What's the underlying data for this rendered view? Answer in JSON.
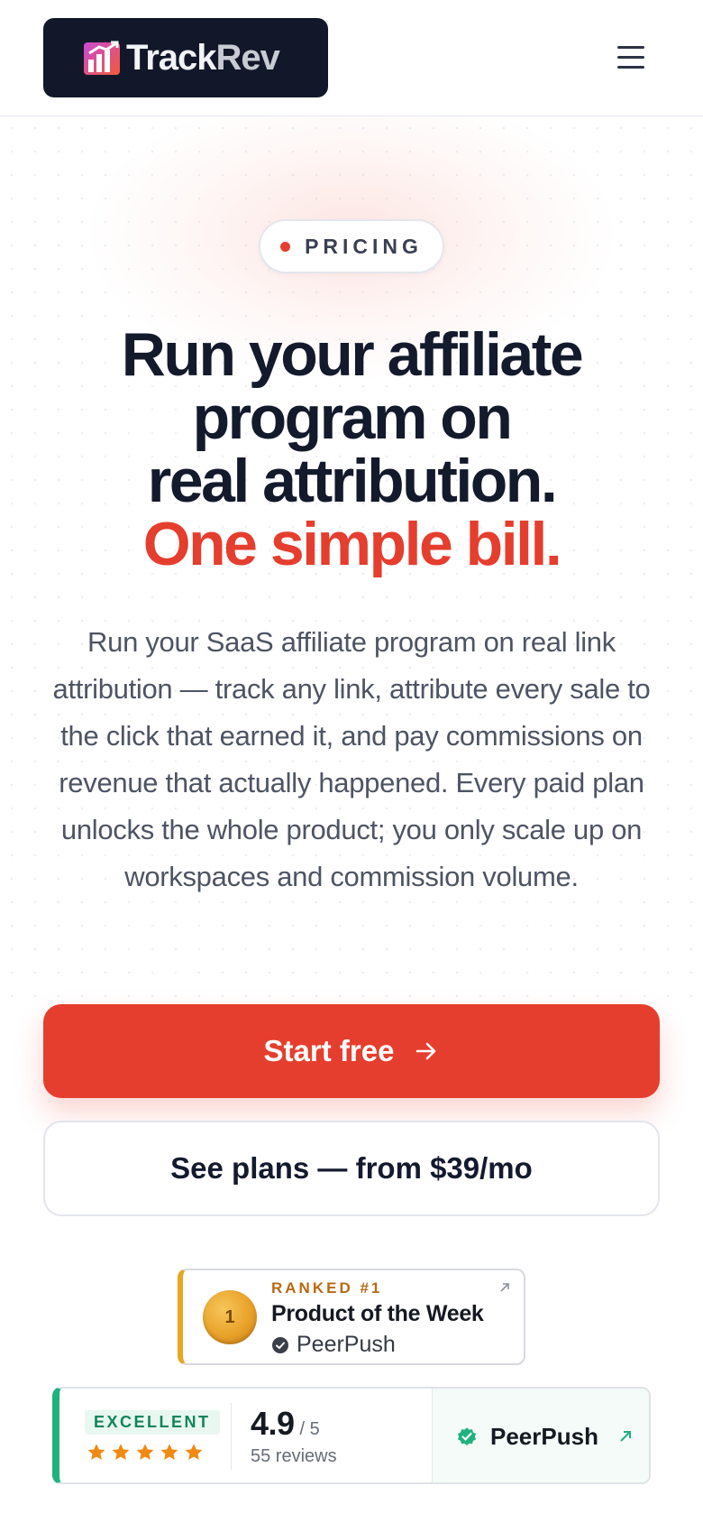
{
  "header": {
    "logo_track": "Track",
    "logo_rev": "Rev",
    "logo_icon": "bar-chart-logo-icon",
    "menu_icon": "hamburger-menu-icon"
  },
  "hero": {
    "badge_label": "PRICING",
    "headline_line1": "Run your affiliate",
    "headline_line2": "program on",
    "headline_line3": "real attribution.",
    "headline_accent": "One simple bill.",
    "description": "Run your SaaS affiliate program on real link attribution — track any link, attribute every sale to the click that earned it, and pay commissions on revenue that actually happened. Every paid plan unlocks the whole product; you only scale up on workspaces and commission volume.",
    "primary_cta": "Start free",
    "secondary_cta": "See plans — from $39/mo"
  },
  "product_of_week": {
    "rank": "RANKED #1",
    "title": "Product of the Week",
    "source": "PeerPush",
    "medal_text": "1"
  },
  "rating": {
    "label": "EXCELLENT",
    "stars": 5,
    "score": "4.9",
    "out_of": "/ 5",
    "reviews": "55 reviews",
    "platform": "PeerPush"
  },
  "colors": {
    "accent": "#e63e2e",
    "dark": "#131a2c",
    "green": "#1fb27e",
    "gold": "#e8a621"
  }
}
